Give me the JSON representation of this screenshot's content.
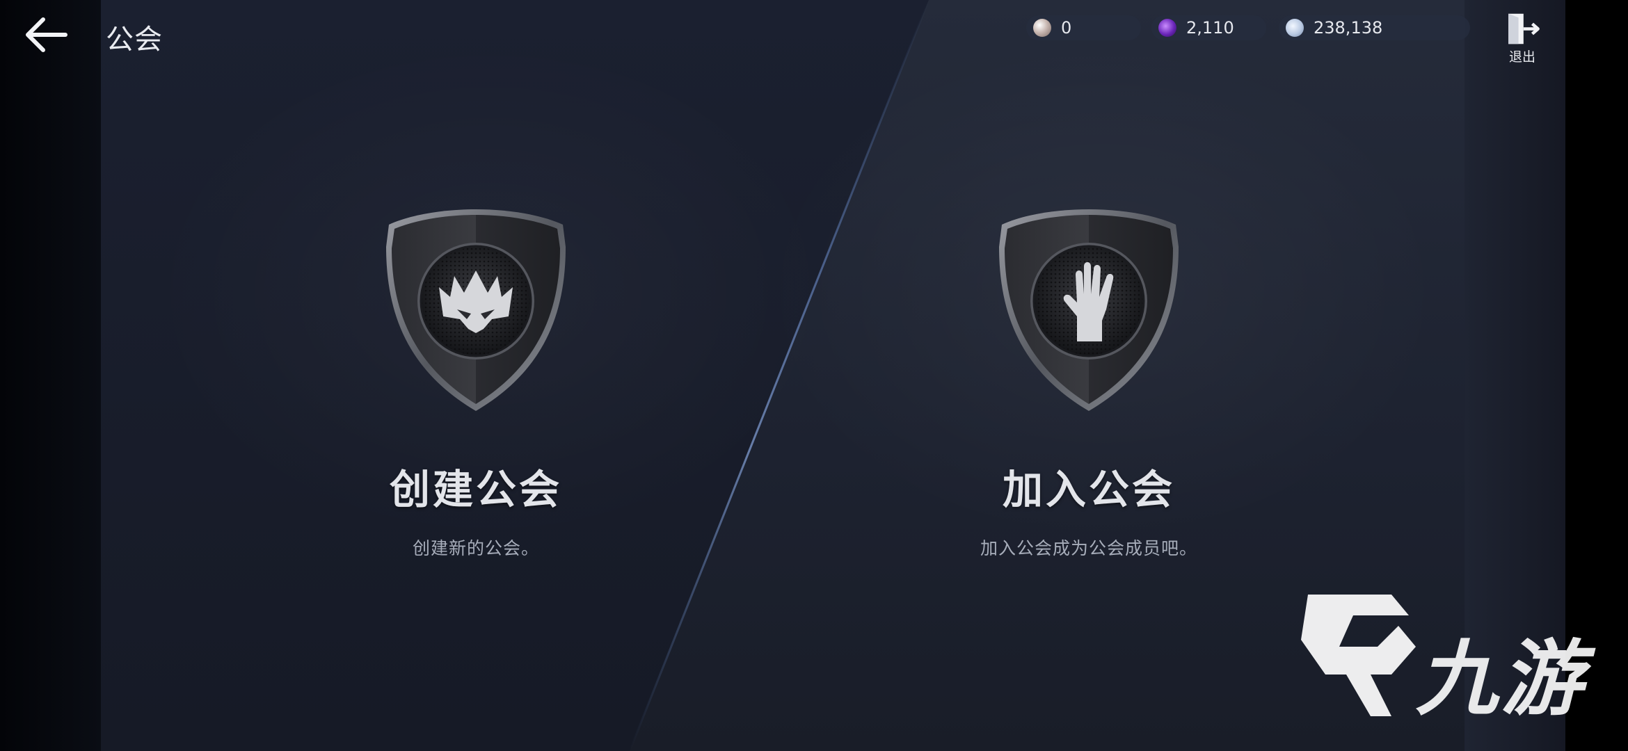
{
  "header": {
    "title": "公会",
    "exit_label": "退出"
  },
  "currencies": {
    "pearl": "0",
    "gem": "2,110",
    "silver": "238,138"
  },
  "options": {
    "create": {
      "title": "创建公会",
      "description": "创建新的公会。",
      "icon": "crown-icon"
    },
    "join": {
      "title": "加入公会",
      "description": "加入公会成为公会成员吧。",
      "icon": "hand-icon"
    }
  },
  "watermark": {
    "text": "九游"
  },
  "colors": {
    "background": "#1a1f2b",
    "accent_line": "#5a7fc0",
    "text_primary": "#e3e5ea",
    "text_secondary": "#a7adba"
  }
}
